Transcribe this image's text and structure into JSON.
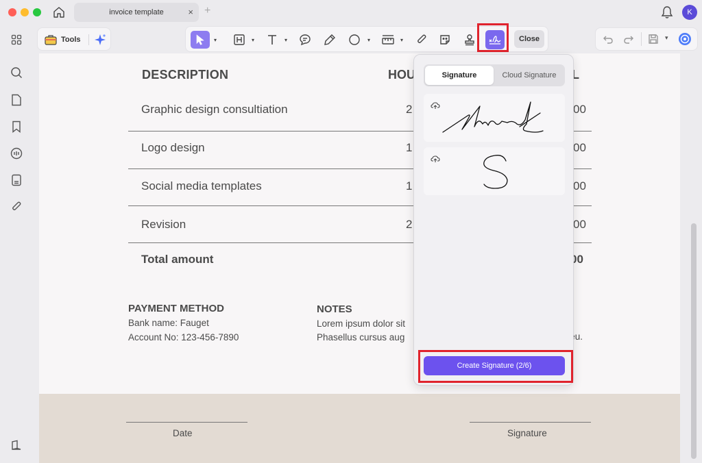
{
  "window": {
    "tab_title": "invoice template",
    "tab_close": "×",
    "tab_add": "+",
    "avatar_initial": "K"
  },
  "colors": {
    "accent": "#6c52ee",
    "highlight_red": "#e0232d",
    "footer_band": "#e3dbd3"
  },
  "sidebar": {
    "items": [
      {
        "icon": "grid-icon"
      },
      {
        "icon": "search-icon"
      },
      {
        "icon": "page-icon"
      },
      {
        "icon": "bookmark-icon"
      },
      {
        "icon": "comment-icon"
      },
      {
        "icon": "form-icon"
      },
      {
        "icon": "attachment-icon"
      }
    ],
    "bottom_icon": "layers-icon"
  },
  "toolbar": {
    "tools_label": "Tools",
    "close_label": "Close",
    "items": [
      "select-tool",
      "text-box-tool",
      "text-tool",
      "comment-tool",
      "pen-tool",
      "shape-tool",
      "measure-tool",
      "attachment-tool",
      "sticker-tool",
      "stamp-tool",
      "signature-tool"
    ]
  },
  "document": {
    "headers": {
      "description": "DESCRIPTION",
      "hours": "HOU",
      "total": "L"
    },
    "rows": [
      {
        "description": "Graphic design consultiation",
        "hours": "2",
        "amount": "00"
      },
      {
        "description": "Logo design",
        "hours": "1",
        "amount": "00"
      },
      {
        "description": "Social media templates",
        "hours": "1",
        "amount": "00"
      },
      {
        "description": "Revision",
        "hours": "2",
        "amount": "00"
      }
    ],
    "total": {
      "label": "Total amount",
      "amount": "00"
    },
    "payment": {
      "title": "PAYMENT METHOD",
      "bank": "Bank name: Fauget",
      "account": "Account No: 123-456-7890"
    },
    "notes": {
      "title": "NOTES",
      "line1": "Lorem ipsum dolor sit",
      "line2": "Phasellus cursus aug",
      "line2_tail": "a eu."
    },
    "footer": {
      "date_label": "Date",
      "signature_label": "Signature"
    }
  },
  "signature_panel": {
    "tabs": [
      "Signature",
      "Cloud Signature"
    ],
    "active_tab": "Signature",
    "create_button": "Create Signature (2/6)"
  }
}
